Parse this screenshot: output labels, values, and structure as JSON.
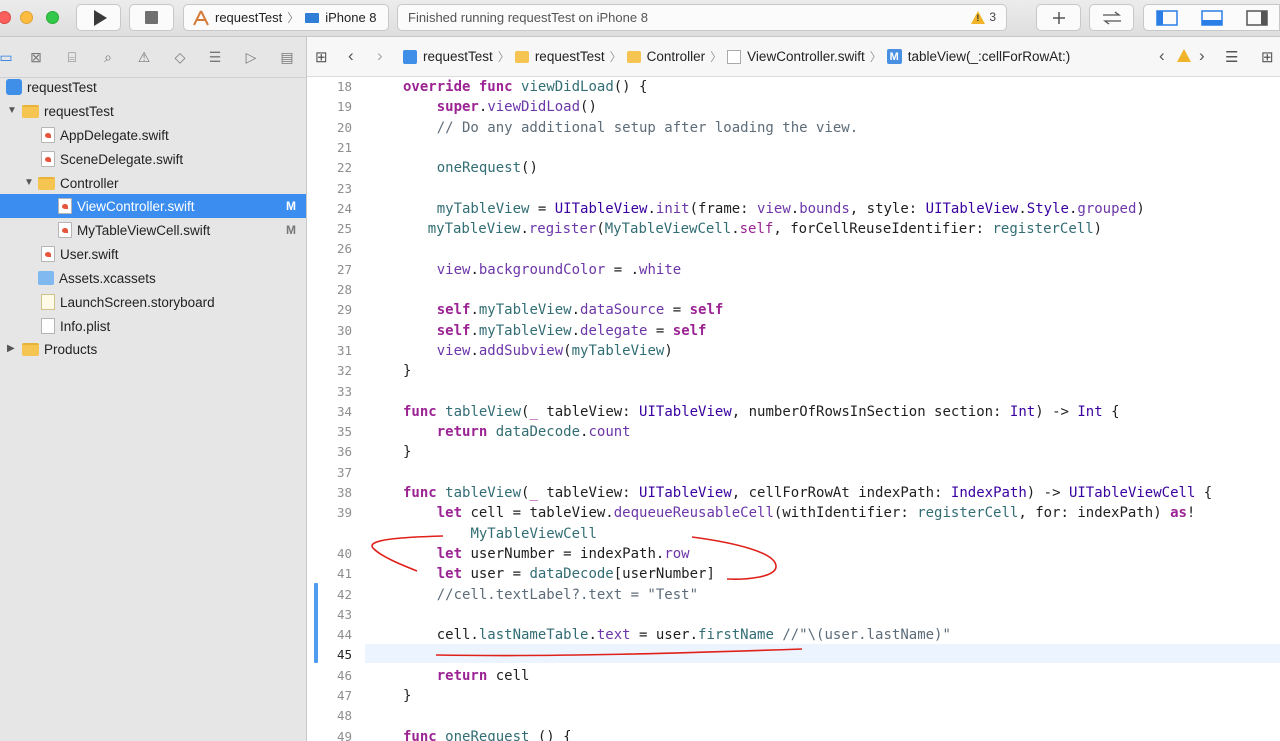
{
  "toolbar": {
    "scheme_project": "requestTest",
    "scheme_device": "iPhone 8",
    "status_text": "Finished running requestTest on iPhone 8",
    "warning_count": "3"
  },
  "navigator": {
    "items": [
      {
        "label": "requestTest"
      },
      {
        "label": "requestTest"
      },
      {
        "label": "AppDelegate.swift"
      },
      {
        "label": "SceneDelegate.swift"
      },
      {
        "label": "Controller"
      },
      {
        "label": "ViewController.swift",
        "badge": "M"
      },
      {
        "label": "MyTableViewCell.swift",
        "badge": "M"
      },
      {
        "label": "User.swift"
      },
      {
        "label": "Assets.xcassets"
      },
      {
        "label": "LaunchScreen.storyboard"
      },
      {
        "label": "Info.plist"
      },
      {
        "label": "Products"
      }
    ]
  },
  "jumpbar": {
    "crumbs": [
      "requestTest",
      "requestTest",
      "Controller",
      "ViewController.swift",
      "tableView(_:cellForRowAt:)"
    ]
  },
  "code": {
    "line_numbers": [
      "18",
      "19",
      "20",
      "21",
      "22",
      "23",
      "24",
      "25",
      "26",
      "27",
      "28",
      "29",
      "30",
      "31",
      "32",
      "33",
      "34",
      "35",
      "36",
      "37",
      "38",
      "39",
      "",
      "40",
      "41",
      "42",
      "43",
      "44",
      "45",
      "46",
      "47",
      "48",
      "49"
    ]
  },
  "colors": {
    "selection": "#3b8ef0",
    "keyword": "#9b2393",
    "type": "#3900a0",
    "comment": "#5d6c79",
    "string": "#c41a16",
    "annotation": "#e0211a"
  }
}
